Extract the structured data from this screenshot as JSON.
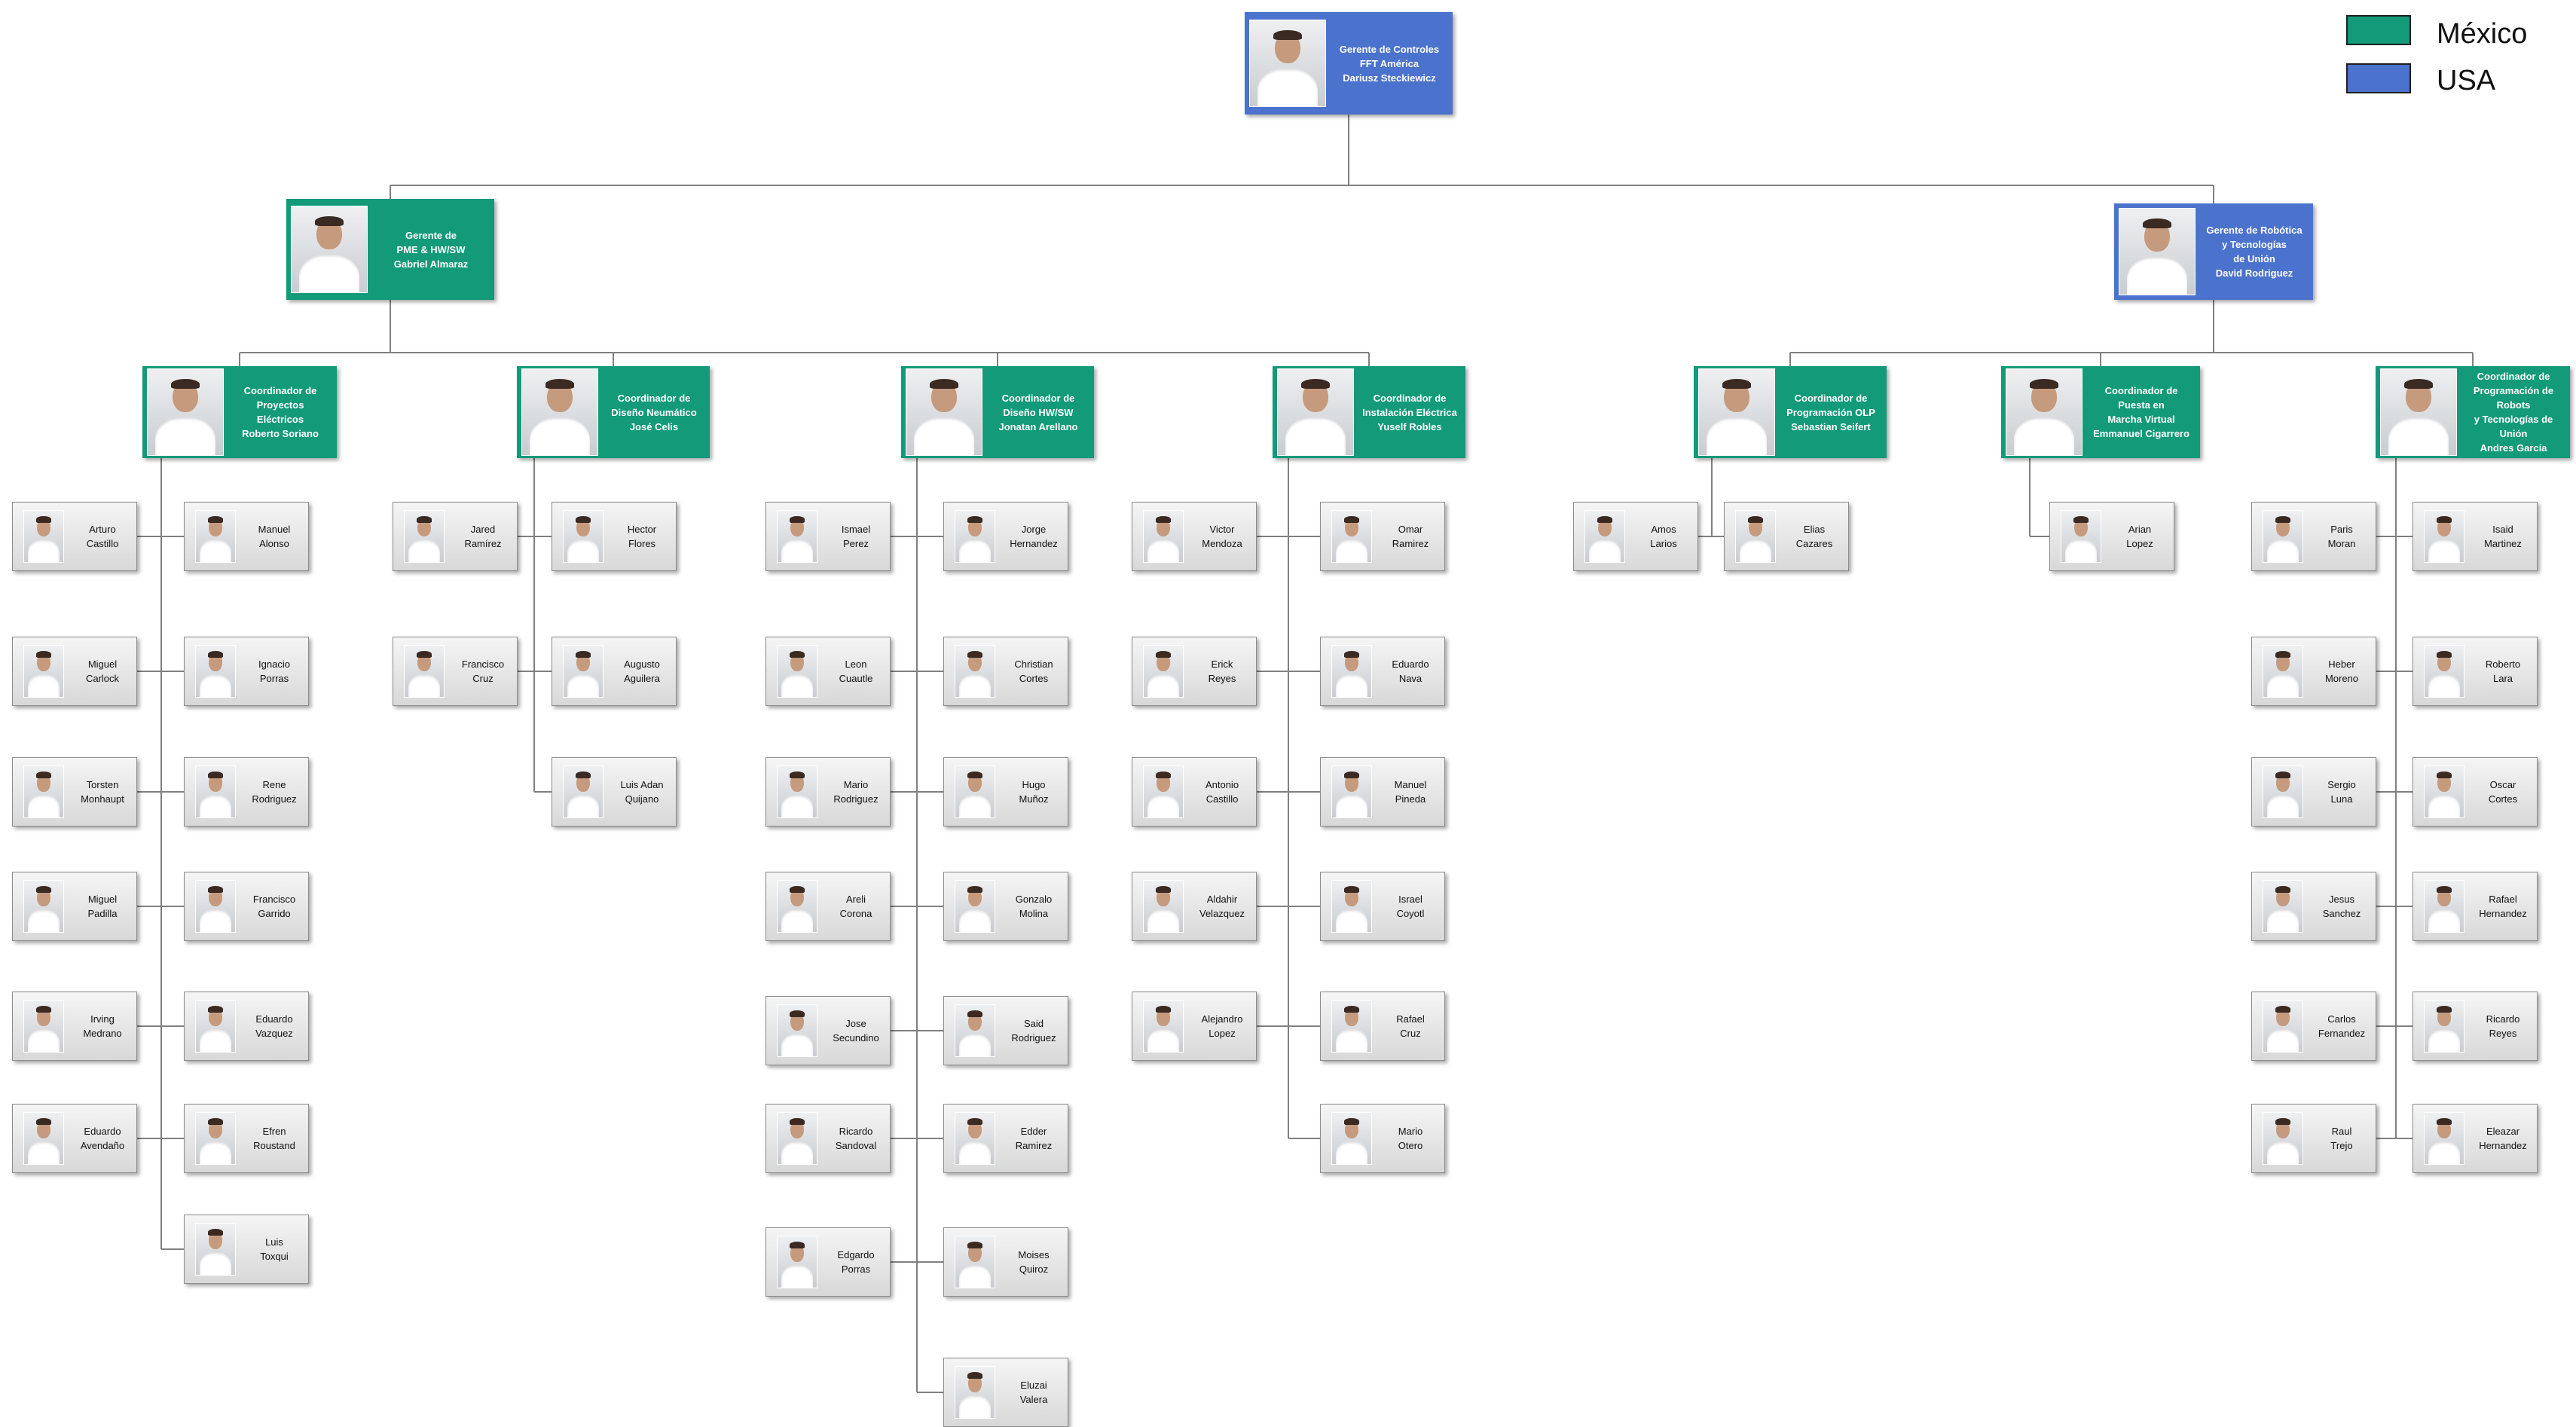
{
  "colors": {
    "mexico": "#129A79",
    "usa": "#4B72CC"
  },
  "legend": [
    {
      "label": "México",
      "color": "#129A79"
    },
    {
      "label": "USA",
      "color": "#4B72CC"
    }
  ],
  "managers": [
    {
      "id": "m0",
      "region": "usa",
      "lines": [
        "Gerente de Controles",
        "FFT América",
        "Dariusz Steckiewicz"
      ]
    },
    {
      "id": "m1",
      "region": "mexico",
      "lines": [
        "Gerente de",
        "PME & HW/SW",
        "Gabriel Almaraz"
      ]
    },
    {
      "id": "m2",
      "region": "usa",
      "lines": [
        "Gerente de Robótica",
        "y Tecnologías",
        "de Unión",
        "David Rodriguez"
      ]
    },
    {
      "id": "c1",
      "region": "mexico",
      "lines": [
        "Coordinador de Proyectos",
        "Eléctricos",
        "Roberto Soriano"
      ]
    },
    {
      "id": "c2",
      "region": "mexico",
      "lines": [
        "Coordinador de",
        "Diseño Neumático",
        "José Celis"
      ]
    },
    {
      "id": "c3",
      "region": "mexico",
      "lines": [
        "Coordinador de",
        "Diseño HW/SW",
        "Jonatan Arellano"
      ]
    },
    {
      "id": "c4",
      "region": "mexico",
      "lines": [
        "Coordinador de",
        "Instalación Eléctrica",
        "Yuself Robles"
      ]
    },
    {
      "id": "c5",
      "region": "mexico",
      "lines": [
        "Coordinador de",
        "Programación OLP",
        "Sebastian Seifert"
      ]
    },
    {
      "id": "c6",
      "region": "mexico",
      "lines": [
        "Coordinador de",
        "Puesta en",
        "Marcha Virtual",
        "Emmanuel Cigarrero"
      ]
    },
    {
      "id": "c7",
      "region": "mexico",
      "lines": [
        "Coordinador de",
        "Programación de Robots",
        "y Tecnologías  de Unión",
        "Andres García"
      ]
    }
  ],
  "employees": [
    {
      "first": "Arturo",
      "last": "Castillo"
    },
    {
      "first": "Manuel",
      "last": "Alonso"
    },
    {
      "first": "Miguel",
      "last": "Carlock"
    },
    {
      "first": "Ignacio",
      "last": "Porras"
    },
    {
      "first": "Torsten",
      "last": "Monhaupt"
    },
    {
      "first": "Rene",
      "last": "Rodriguez"
    },
    {
      "first": "Miguel",
      "last": "Padilla"
    },
    {
      "first": "Francisco",
      "last": "Garrido"
    },
    {
      "first": "Irving",
      "last": "Medrano"
    },
    {
      "first": "Eduardo",
      "last": "Vazquez"
    },
    {
      "first": "Eduardo",
      "last": "Avendaño"
    },
    {
      "first": "Efren",
      "last": "Roustand"
    },
    {
      "first": "Luis",
      "last": "Toxqui"
    },
    {
      "first": "Jared",
      "last": "Ramírez"
    },
    {
      "first": "Hector",
      "last": "Flores"
    },
    {
      "first": "Francisco",
      "last": "Cruz"
    },
    {
      "first": "Augusto",
      "last": "Aguilera"
    },
    {
      "first": "Luis Adan",
      "last": "Quijano"
    },
    {
      "first": "Ismael",
      "last": "Perez"
    },
    {
      "first": "Jorge",
      "last": "Hernandez"
    },
    {
      "first": "Leon",
      "last": "Cuautle"
    },
    {
      "first": "Christian",
      "last": "Cortes"
    },
    {
      "first": "Mario",
      "last": "Rodriguez"
    },
    {
      "first": "Hugo",
      "last": "Muñoz"
    },
    {
      "first": "Areli",
      "last": "Corona"
    },
    {
      "first": "Gonzalo",
      "last": "Molina"
    },
    {
      "first": "Jose",
      "last": "Secundino"
    },
    {
      "first": "Said",
      "last": "Rodriguez"
    },
    {
      "first": "Ricardo",
      "last": "Sandoval"
    },
    {
      "first": "Edder",
      "last": "Ramirez"
    },
    {
      "first": "Edgardo",
      "last": "Porras"
    },
    {
      "first": "Moises",
      "last": "Quiroz"
    },
    {
      "first": "Eluzai",
      "last": "Valera"
    },
    {
      "first": "Victor",
      "last": "Mendoza"
    },
    {
      "first": "Omar",
      "last": "Ramirez"
    },
    {
      "first": "Erick",
      "last": "Reyes"
    },
    {
      "first": "Eduardo",
      "last": "Nava"
    },
    {
      "first": "Antonio",
      "last": "Castillo"
    },
    {
      "first": "Manuel",
      "last": "Pineda"
    },
    {
      "first": "Aldahir",
      "last": "Velazquez"
    },
    {
      "first": "Israel",
      "last": "Coyotl"
    },
    {
      "first": "Alejandro",
      "last": "Lopez"
    },
    {
      "first": "Rafael",
      "last": "Cruz"
    },
    {
      "first": "Mario",
      "last": "Otero"
    },
    {
      "first": "Amos",
      "last": "Larios"
    },
    {
      "first": "Elias",
      "last": "Cazares"
    },
    {
      "first": "Arian",
      "last": "Lopez"
    },
    {
      "first": "Paris",
      "last": "Moran"
    },
    {
      "first": "Isaid",
      "last": "Martinez"
    },
    {
      "first": "Heber",
      "last": "Moreno"
    },
    {
      "first": "Roberto",
      "last": "Lara"
    },
    {
      "first": "Sergio",
      "last": "Luna"
    },
    {
      "first": "Oscar",
      "last": "Cortes"
    },
    {
      "first": "Jesus",
      "last": "Sanchez"
    },
    {
      "first": "Rafael",
      "last": "Hernandez"
    },
    {
      "first": "Carlos",
      "last": "Fernandez"
    },
    {
      "first": "Ricardo",
      "last": "Reyes"
    },
    {
      "first": "Raul",
      "last": "Trejo"
    },
    {
      "first": "Eleazar",
      "last": "Hernandez"
    }
  ]
}
